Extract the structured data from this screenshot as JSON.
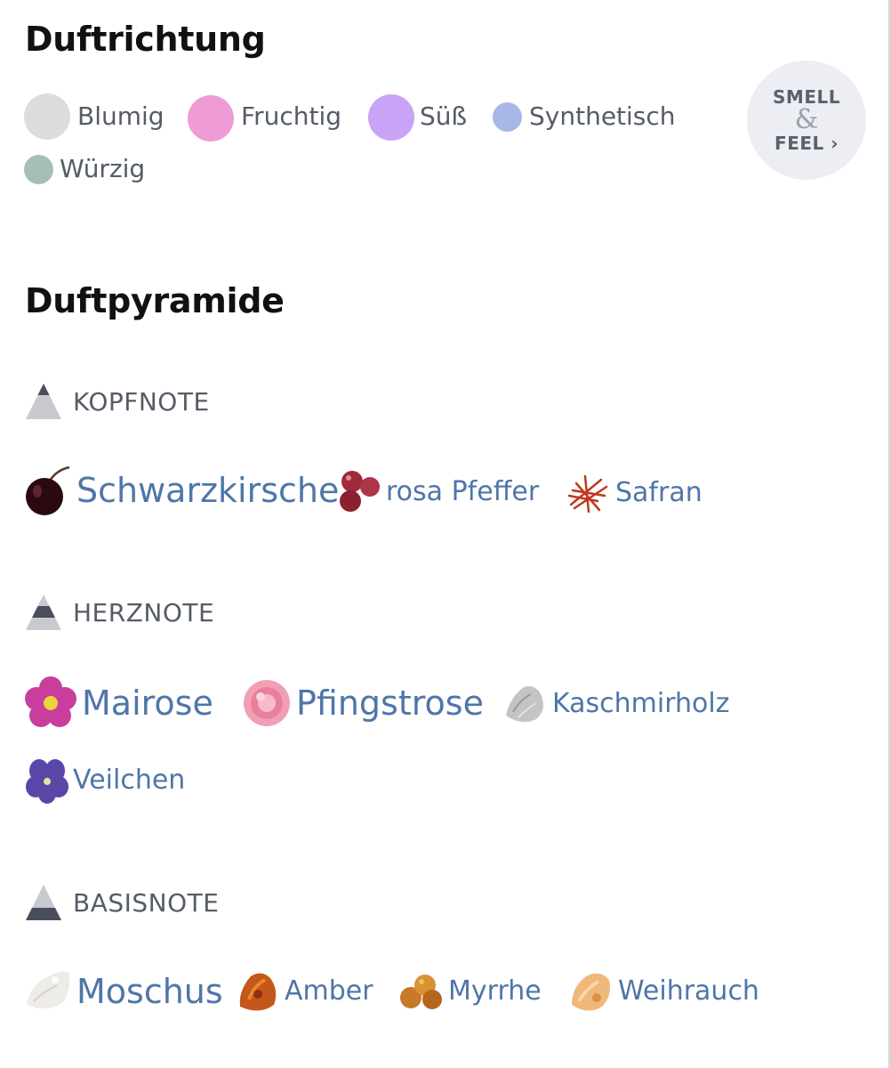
{
  "duftrichtung": {
    "title": "Duftrichtung",
    "categories": [
      {
        "label": "Blumig",
        "color": "#dcdcdc"
      },
      {
        "label": "Fruchtig",
        "color": "#ef9bd6"
      },
      {
        "label": "Süß",
        "color": "#c9a3f5"
      },
      {
        "label": "Synthetisch",
        "color": "#a9b6e8"
      },
      {
        "label": "Würzig",
        "color": "#a6bfb6"
      }
    ],
    "smell_feel": {
      "line1": "SMELL",
      "amp": "&",
      "line2": "FEEL ›"
    }
  },
  "duftpyramide": {
    "title": "Duftpyramide",
    "kopfnote": {
      "label": "KOPFNOTE",
      "notes": [
        {
          "label": "Schwarzkirsche",
          "icon": "cherry-icon"
        },
        {
          "label": "rosa Pfeffer",
          "icon": "pink-pepper-icon"
        },
        {
          "label": "Safran",
          "icon": "saffron-icon"
        }
      ]
    },
    "herznote": {
      "label": "HERZNOTE",
      "notes": [
        {
          "label": "Mairose",
          "icon": "may-rose-icon"
        },
        {
          "label": "Pfingstrose",
          "icon": "peony-icon"
        },
        {
          "label": "Kaschmirholz",
          "icon": "cashmere-wood-icon"
        },
        {
          "label": "Veilchen",
          "icon": "violet-icon"
        }
      ]
    },
    "basisnote": {
      "label": "BASISNOTE",
      "notes": [
        {
          "label": "Moschus",
          "icon": "musk-icon"
        },
        {
          "label": "Amber",
          "icon": "amber-icon"
        },
        {
          "label": "Myrrhe",
          "icon": "myrrh-icon"
        },
        {
          "label": "Weihrauch",
          "icon": "frankincense-icon"
        }
      ]
    }
  }
}
